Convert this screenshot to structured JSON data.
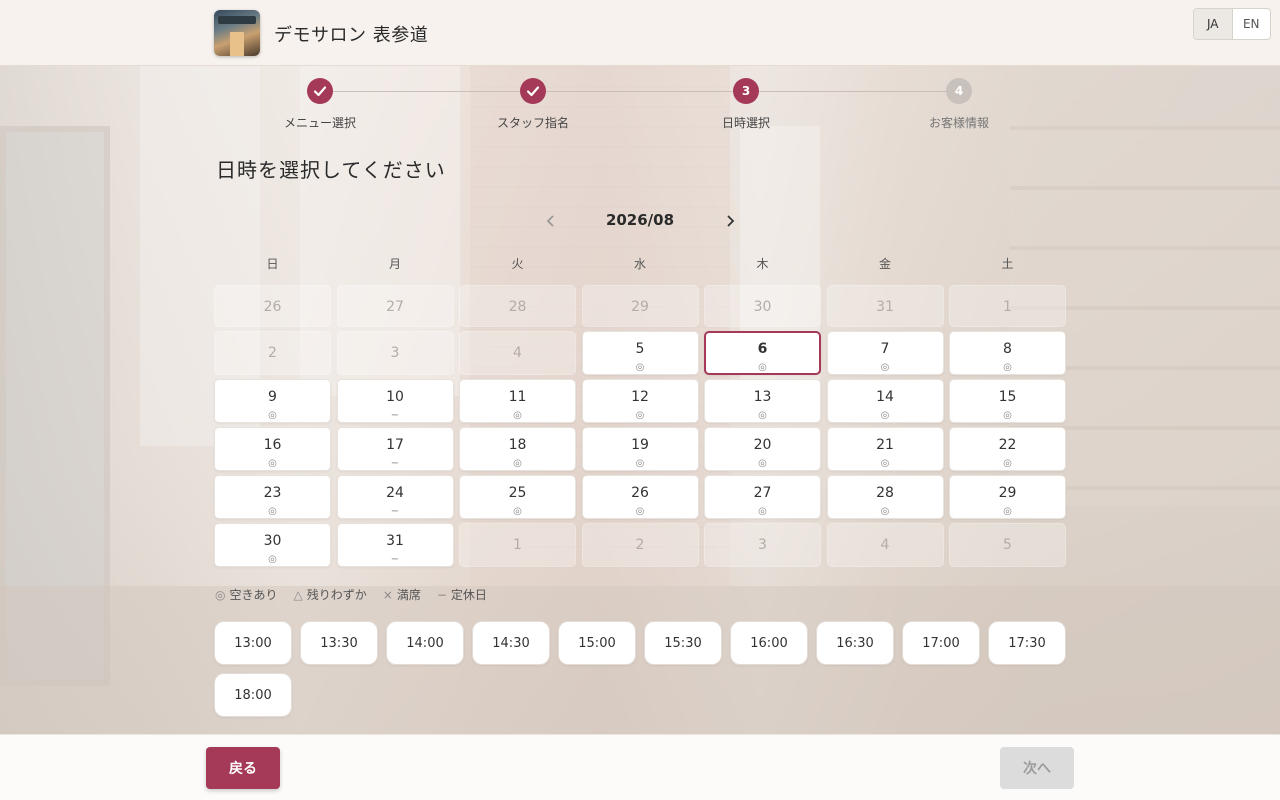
{
  "header": {
    "salon_name": "デモサロン 表参道",
    "lang_ja": "JA",
    "lang_en": "EN",
    "active_lang": "JA"
  },
  "stepper": {
    "steps": [
      {
        "number": "1",
        "label": "メニュー選択",
        "status": "done"
      },
      {
        "number": "2",
        "label": "スタッフ指名",
        "status": "done"
      },
      {
        "number": "3",
        "label": "日時選択",
        "status": "current"
      },
      {
        "number": "4",
        "label": "お客様情報",
        "status": "todo"
      }
    ]
  },
  "page_title": "日時を選択してください",
  "calendar": {
    "month_label": "2026/08",
    "weekdays": [
      "日",
      "月",
      "火",
      "水",
      "木",
      "金",
      "土"
    ],
    "selected_day": "6",
    "days": [
      {
        "d": "26",
        "m": "",
        "state": "muted"
      },
      {
        "d": "27",
        "m": "",
        "state": "muted"
      },
      {
        "d": "28",
        "m": "",
        "state": "muted"
      },
      {
        "d": "29",
        "m": "",
        "state": "muted"
      },
      {
        "d": "30",
        "m": "",
        "state": "muted"
      },
      {
        "d": "31",
        "m": "",
        "state": "muted"
      },
      {
        "d": "1",
        "m": "",
        "state": "muted"
      },
      {
        "d": "2",
        "m": "",
        "state": "muted"
      },
      {
        "d": "3",
        "m": "",
        "state": "muted"
      },
      {
        "d": "4",
        "m": "",
        "state": "muted"
      },
      {
        "d": "5",
        "m": "◎",
        "state": "open"
      },
      {
        "d": "6",
        "m": "◎",
        "state": "selected"
      },
      {
        "d": "7",
        "m": "◎",
        "state": "open"
      },
      {
        "d": "8",
        "m": "◎",
        "state": "open"
      },
      {
        "d": "9",
        "m": "◎",
        "state": "open"
      },
      {
        "d": "10",
        "m": "−",
        "state": "closed"
      },
      {
        "d": "11",
        "m": "◎",
        "state": "open"
      },
      {
        "d": "12",
        "m": "◎",
        "state": "open"
      },
      {
        "d": "13",
        "m": "◎",
        "state": "open"
      },
      {
        "d": "14",
        "m": "◎",
        "state": "open"
      },
      {
        "d": "15",
        "m": "◎",
        "state": "open"
      },
      {
        "d": "16",
        "m": "◎",
        "state": "open"
      },
      {
        "d": "17",
        "m": "−",
        "state": "closed"
      },
      {
        "d": "18",
        "m": "◎",
        "state": "open"
      },
      {
        "d": "19",
        "m": "◎",
        "state": "open"
      },
      {
        "d": "20",
        "m": "◎",
        "state": "open"
      },
      {
        "d": "21",
        "m": "◎",
        "state": "open"
      },
      {
        "d": "22",
        "m": "◎",
        "state": "open"
      },
      {
        "d": "23",
        "m": "◎",
        "state": "open"
      },
      {
        "d": "24",
        "m": "−",
        "state": "closed"
      },
      {
        "d": "25",
        "m": "◎",
        "state": "open"
      },
      {
        "d": "26",
        "m": "◎",
        "state": "open"
      },
      {
        "d": "27",
        "m": "◎",
        "state": "open"
      },
      {
        "d": "28",
        "m": "◎",
        "state": "open"
      },
      {
        "d": "29",
        "m": "◎",
        "state": "open"
      },
      {
        "d": "30",
        "m": "◎",
        "state": "open"
      },
      {
        "d": "31",
        "m": "−",
        "state": "closed"
      },
      {
        "d": "1",
        "m": "",
        "state": "muted"
      },
      {
        "d": "2",
        "m": "",
        "state": "muted"
      },
      {
        "d": "3",
        "m": "",
        "state": "muted"
      },
      {
        "d": "4",
        "m": "",
        "state": "muted"
      },
      {
        "d": "5",
        "m": "",
        "state": "muted"
      }
    ]
  },
  "legend": [
    {
      "symbol": "◎",
      "label": "空きあり"
    },
    {
      "symbol": "△",
      "label": "残りわずか"
    },
    {
      "symbol": "×",
      "label": "満席"
    },
    {
      "symbol": "−",
      "label": "定休日"
    }
  ],
  "time_slots": [
    "13:00",
    "13:30",
    "14:00",
    "14:30",
    "15:00",
    "15:30",
    "16:00",
    "16:30",
    "17:00",
    "17:30",
    "18:00"
  ],
  "footer": {
    "back_label": "戻る",
    "next_label": "次へ",
    "next_enabled": false
  },
  "colors": {
    "accent": "#a43a58",
    "disabled": "#dcdcdc"
  },
  "icons": {
    "check": "check-icon",
    "prev_month": "chevron-left-icon",
    "next_month": "chevron-right-icon"
  }
}
